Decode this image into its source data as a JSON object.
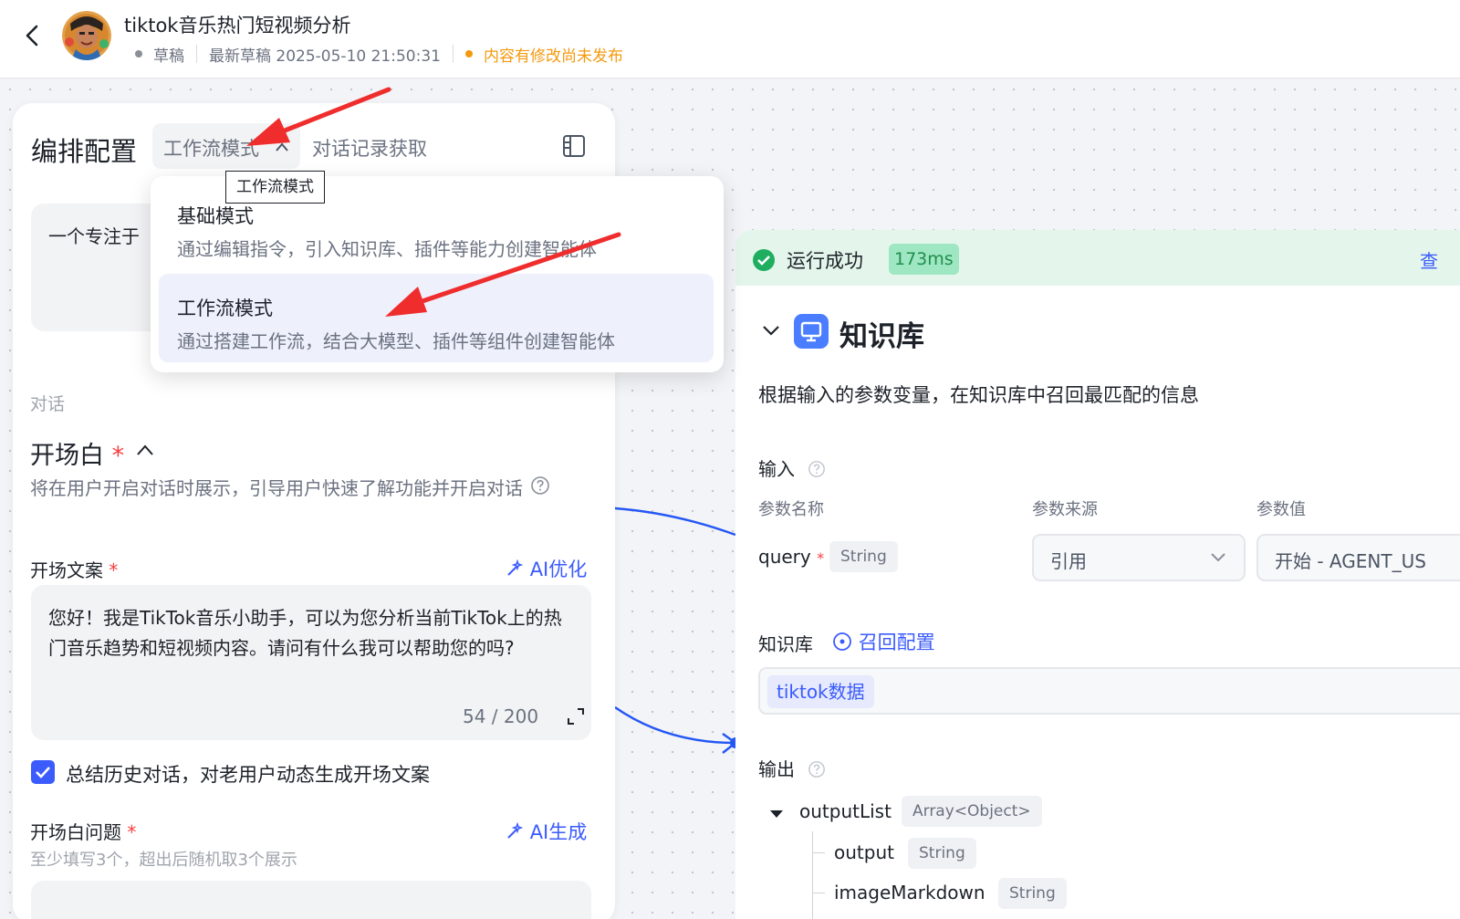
{
  "header": {
    "title": "tiktok音乐热门短视频分析",
    "status": "草稿",
    "draft_time": "最新草稿 2025-05-10 21:50:31",
    "warning": "内容有修改尚未发布"
  },
  "config": {
    "title": "编排配置",
    "mode_label": "工作流模式",
    "history_tab": "对话记录获取",
    "persona_snippet": "一个专注于",
    "section_dialog": "对话",
    "opening_title": "开场白",
    "opening_desc": "将在用户开启对话时展示，引导用户快速了解功能并开启对话",
    "opening_text_label": "开场文案",
    "ai_optimize": "AI优化",
    "opening_text": "您好！我是TikTok音乐小助手，可以为您分析当前TikTok上的热门音乐趋势和短视频内容。请问有什么我可以帮助您的吗?",
    "char_count": "54 / 200",
    "summarize_label": "总结历史对话，对老用户动态生成开场文案",
    "questions_label": "开场白问题",
    "ai_generate": "AI生成",
    "questions_hint": "至少填写3个，超出后随机取3个展示"
  },
  "dropdown": {
    "tooltip": "工作流模式",
    "items": [
      {
        "title": "基础模式",
        "desc": "通过编辑指令，引入知识库、插件等能力创建智能体"
      },
      {
        "title": "工作流模式",
        "desc": "通过搭建工作流，结合大模型、插件等组件创建智能体"
      }
    ]
  },
  "node": {
    "run_status": "运行成功",
    "run_time": "173ms",
    "run_view": "查",
    "title": "知识库",
    "desc": "根据输入的参数变量，在知识库中召回最匹配的信息",
    "input_label": "输入",
    "col_name": "参数名称",
    "col_source": "参数来源",
    "col_value": "参数值",
    "param_name": "query",
    "param_type": "String",
    "param_source": "引用",
    "param_value": "开始 - AGENT_US",
    "kb_label": "知识库",
    "recall_config": "召回配置",
    "kb_chip": "tiktok数据",
    "output_label": "输出",
    "outputs": [
      {
        "name": "outputList",
        "type": "Array<Object>"
      },
      {
        "name": "output",
        "type": "String"
      },
      {
        "name": "imageMarkdown",
        "type": "String"
      }
    ]
  },
  "colors": {
    "accent": "#3b5bfd",
    "success": "#1f8f4e",
    "warning": "#f39a0e",
    "required": "#f53f3f",
    "annotation_arrow": "#ef2d2d"
  },
  "icons": [
    "back-icon",
    "avatar",
    "layout-icon",
    "chevron-up-icon",
    "help-icon",
    "magic-wand-icon",
    "expand-icon",
    "check-icon",
    "success-icon",
    "chevron-down-icon",
    "knowledge-icon",
    "recall-config-icon",
    "caret-down-icon"
  ]
}
